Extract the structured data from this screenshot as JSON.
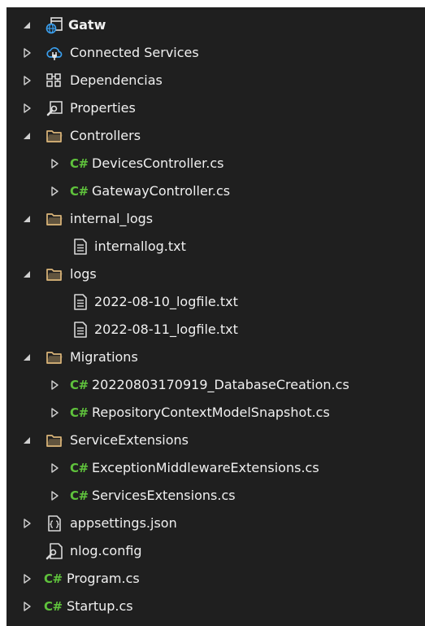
{
  "solution_explorer": {
    "project": {
      "name": "Gatw",
      "expanded": true
    },
    "nodes": [
      {
        "label": "Connected Services",
        "icon": "connected-services-icon",
        "indent": 1,
        "expander": "collapsed"
      },
      {
        "label": "Dependencias",
        "icon": "dependencies-icon",
        "indent": 1,
        "expander": "collapsed"
      },
      {
        "label": "Properties",
        "icon": "properties-wrench-icon",
        "indent": 1,
        "expander": "collapsed"
      },
      {
        "label": "Controllers",
        "icon": "folder-open-icon",
        "indent": 1,
        "expander": "expanded"
      },
      {
        "label": "DevicesController.cs",
        "icon": "csharp-file-icon",
        "indent": 2,
        "expander": "collapsed"
      },
      {
        "label": "GatewayController.cs",
        "icon": "csharp-file-icon",
        "indent": 2,
        "expander": "collapsed"
      },
      {
        "label": "internal_logs",
        "icon": "folder-open-icon",
        "indent": 1,
        "expander": "expanded"
      },
      {
        "label": "internallog.txt",
        "icon": "text-file-icon",
        "indent": 2,
        "expander": "none"
      },
      {
        "label": "logs",
        "icon": "folder-open-icon",
        "indent": 1,
        "expander": "expanded"
      },
      {
        "label": "2022-08-10_logfile.txt",
        "icon": "text-file-icon",
        "indent": 2,
        "expander": "none"
      },
      {
        "label": "2022-08-11_logfile.txt",
        "icon": "text-file-icon",
        "indent": 2,
        "expander": "none"
      },
      {
        "label": "Migrations",
        "icon": "folder-open-icon",
        "indent": 1,
        "expander": "expanded"
      },
      {
        "label": "20220803170919_DatabaseCreation.cs",
        "icon": "csharp-file-icon",
        "indent": 2,
        "expander": "collapsed"
      },
      {
        "label": "RepositoryContextModelSnapshot.cs",
        "icon": "csharp-file-icon",
        "indent": 2,
        "expander": "collapsed"
      },
      {
        "label": "ServiceExtensions",
        "icon": "folder-open-icon",
        "indent": 1,
        "expander": "expanded"
      },
      {
        "label": "ExceptionMiddlewareExtensions.cs",
        "icon": "csharp-file-icon",
        "indent": 2,
        "expander": "collapsed"
      },
      {
        "label": "ServicesExtensions.cs",
        "icon": "csharp-file-icon",
        "indent": 2,
        "expander": "collapsed"
      },
      {
        "label": "appsettings.json",
        "icon": "json-file-icon",
        "indent": 1,
        "expander": "collapsed"
      },
      {
        "label": "nlog.config",
        "icon": "config-file-icon",
        "indent": 1,
        "expander": "none"
      },
      {
        "label": "Program.cs",
        "icon": "csharp-file-icon",
        "indent": 1,
        "expander": "collapsed"
      },
      {
        "label": "Startup.cs",
        "icon": "csharp-file-icon",
        "indent": 1,
        "expander": "collapsed"
      }
    ],
    "csharp_badge": "C#",
    "colors": {
      "background": "#1f1f1f",
      "text": "#f0f0f0",
      "folder": "#dcb67a",
      "csharp": "#5fc23c",
      "connected": "#3aa0f0",
      "arrow": "#d0d0d0"
    }
  }
}
